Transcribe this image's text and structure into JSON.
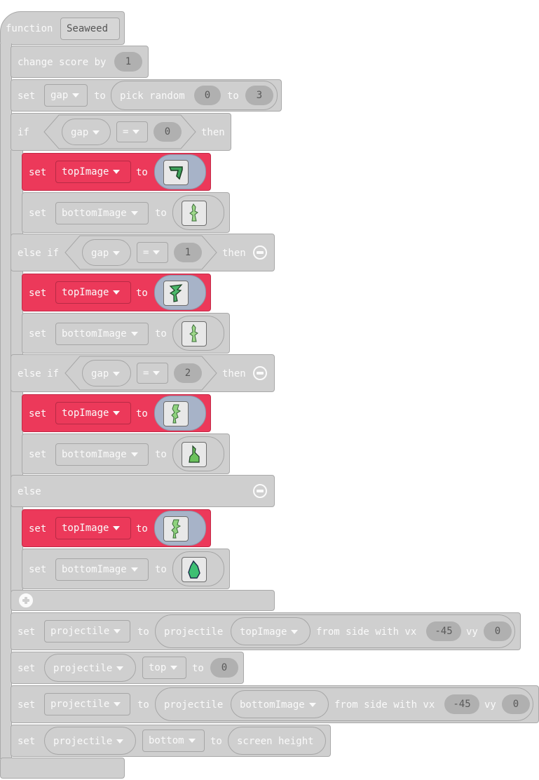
{
  "function_block": {
    "keyword": "function",
    "name": "Seaweed"
  },
  "change_score": {
    "label": "change score by",
    "value": "1"
  },
  "set_gap": {
    "set": "set",
    "variable": "gap",
    "to": "to",
    "random_label": "pick random",
    "min": "0",
    "random_to": "to",
    "max": "3"
  },
  "if_block": {
    "if_kw": "if",
    "var": "gap",
    "op": "=",
    "value": "0",
    "then": "then",
    "rows": [
      {
        "set": "set",
        "variable": "topImage",
        "to": "to",
        "image": "seaweed-curl-icon"
      },
      {
        "set": "set",
        "variable": "bottomImage",
        "to": "to",
        "image": "seaweed-tall-icon"
      }
    ]
  },
  "else_if_1": {
    "kw": "else if",
    "var": "gap",
    "op": "=",
    "value": "1",
    "then": "then",
    "rows": [
      {
        "set": "set",
        "variable": "topImage",
        "to": "to",
        "image": "seaweed-leafy-icon"
      },
      {
        "set": "set",
        "variable": "bottomImage",
        "to": "to",
        "image": "seaweed-tall-icon"
      }
    ]
  },
  "else_if_2": {
    "kw": "else if",
    "var": "gap",
    "op": "=",
    "value": "2",
    "then": "then",
    "rows": [
      {
        "set": "set",
        "variable": "topImage",
        "to": "to",
        "image": "seaweed-stalk-icon"
      },
      {
        "set": "set",
        "variable": "bottomImage",
        "to": "to",
        "image": "seaweed-wide-icon"
      }
    ]
  },
  "else_block": {
    "kw": "else",
    "rows": [
      {
        "set": "set",
        "variable": "topImage",
        "to": "to",
        "image": "seaweed-stalk-icon"
      },
      {
        "set": "set",
        "variable": "bottomImage",
        "to": "to",
        "image": "seaweed-bush-icon"
      }
    ]
  },
  "proj_top": {
    "set": "set",
    "variable": "projectile",
    "to": "to",
    "func": "projectile",
    "image_var": "topImage",
    "from": "from side with vx",
    "vx": "-45",
    "vy_label": "vy",
    "vy": "0"
  },
  "proj_top_pos": {
    "set": "set",
    "sprite": "projectile",
    "prop": "top",
    "to": "to",
    "value": "0"
  },
  "proj_bottom": {
    "set": "set",
    "variable": "projectile",
    "to": "to",
    "func": "projectile",
    "image_var": "bottomImage",
    "from": "from side with vx",
    "vx": "-45",
    "vy_label": "vy",
    "vy": "0"
  },
  "proj_bottom_pos": {
    "set": "set",
    "sprite": "projectile",
    "prop": "bottom",
    "to": "to",
    "value": "screen height"
  },
  "colors": {
    "block_gray": "#cfcfcf",
    "block_red": "#ec395a",
    "image_slot_blue": "#a7b3c8"
  }
}
